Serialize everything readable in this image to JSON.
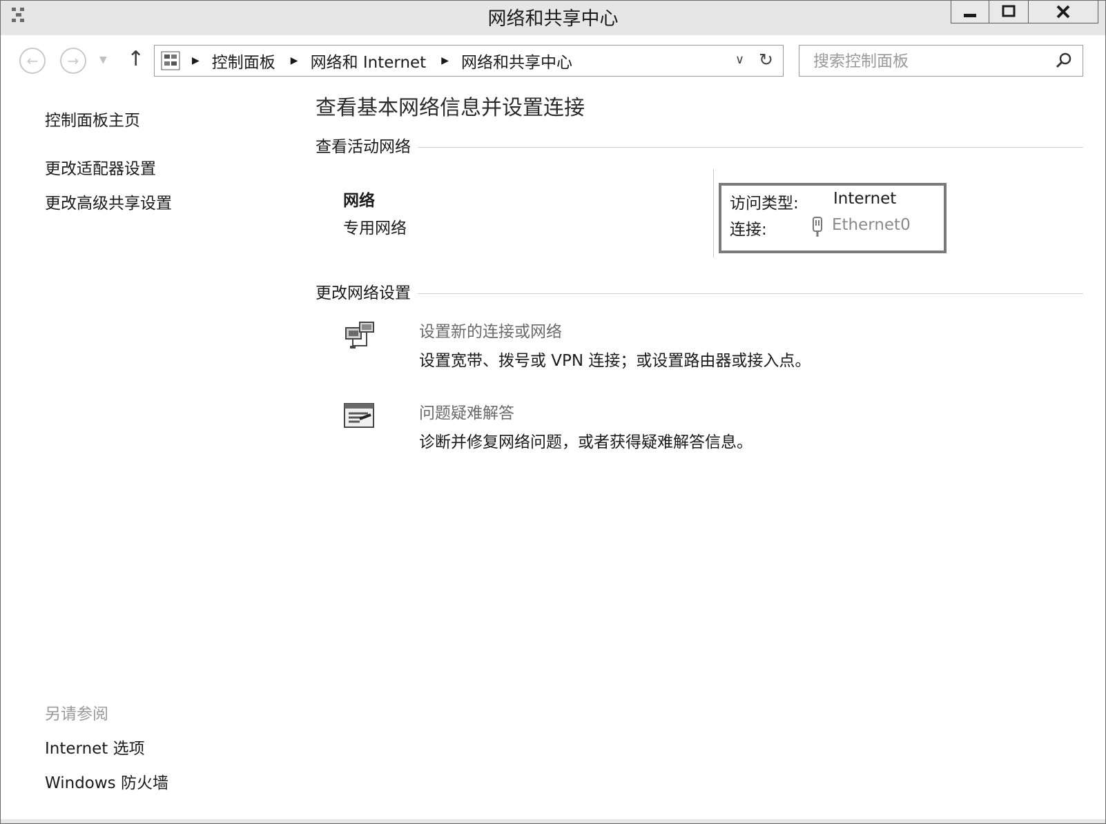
{
  "window": {
    "title": "网络和共享中心",
    "controls": {
      "minimize": "minimize-icon",
      "maximize": "maximize-icon",
      "close": "close-icon"
    }
  },
  "nav": {
    "back_icon": "back-arrow-icon",
    "forward_icon": "forward-arrow-icon",
    "up_icon": "up-arrow-icon"
  },
  "address": {
    "icon": "control-panel-icon",
    "crumbs": [
      "控制面板",
      "网络和 Internet",
      "网络和共享中心"
    ]
  },
  "search": {
    "placeholder": "搜索控制面板"
  },
  "sidebar": {
    "links": [
      "控制面板主页",
      "更改适配器设置",
      "更改高级共享设置"
    ],
    "see_also_title": "另请参阅",
    "see_also_links": [
      "Internet 选项",
      "Windows 防火墙"
    ]
  },
  "main": {
    "title": "查看基本网络信息并设置连接",
    "active_section": "查看活动网络",
    "network": {
      "name": "网络",
      "type": "专用网络",
      "access_label": "访问类型:",
      "access_value": "Internet",
      "connection_label": "连接:",
      "connection_value": "Ethernet0"
    },
    "change_section": "更改网络设置",
    "tasks": [
      {
        "icon": "network-setup-icon",
        "link": "设置新的连接或网络",
        "desc": "设置宽带、拨号或 VPN 连接；或设置路由器或接入点。"
      },
      {
        "icon": "troubleshoot-icon",
        "link": "问题疑难解答",
        "desc": "诊断并修复网络问题，或者获得疑难解答信息。"
      }
    ]
  }
}
